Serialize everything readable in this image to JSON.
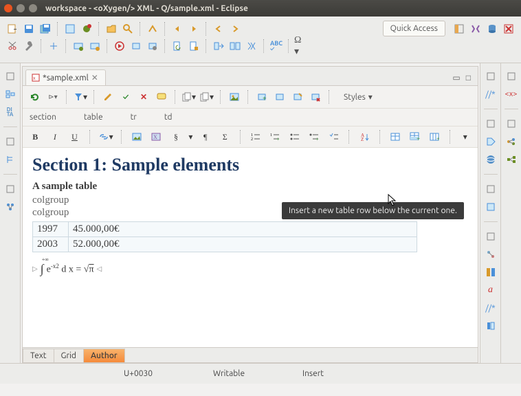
{
  "window": {
    "title": "workspace - <oXygen/> XML - Q/sample.xml - Eclipse"
  },
  "quick_access": "Quick Access",
  "editor_tab": {
    "label": "*sample.xml"
  },
  "styles_label": "Styles",
  "breadcrumb": [
    "section",
    "table",
    "tr",
    "td"
  ],
  "format": {
    "bold": "B",
    "italic": "I",
    "underline": "U",
    "sigma": "Σ",
    "para": "¶",
    "section_sym": "§"
  },
  "content": {
    "heading": "Section 1: Sample elements",
    "table_caption": "A sample table",
    "colgroup": "colgroup",
    "rows": [
      {
        "year": "1997",
        "value": "45.000,00€"
      },
      {
        "year": "2003",
        "value": "52.000,00€"
      }
    ],
    "math_left_bound": "+∞",
    "math_int": "∫",
    "math_expr_1": "e",
    "math_sup": "-x2",
    "math_dx": " d x = ",
    "math_sqrt": "√",
    "math_pi_overline": "π"
  },
  "tooltip": "Insert a new table row below the current one.",
  "bottom_tabs": {
    "text": "Text",
    "grid": "Grid",
    "author": "Author"
  },
  "status": {
    "code": "U+0030",
    "mode": "Writable",
    "insert": "Insert"
  }
}
